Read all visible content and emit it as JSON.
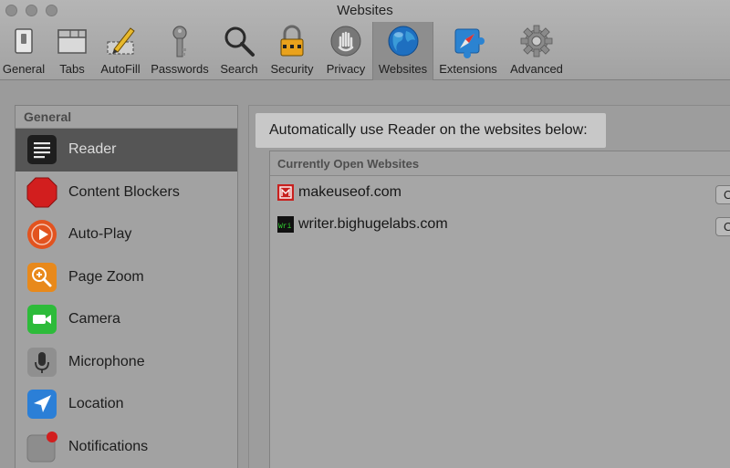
{
  "window": {
    "title": "Websites"
  },
  "toolbar": {
    "items": [
      {
        "label": "General",
        "icon": "general-switch-icon"
      },
      {
        "label": "Tabs",
        "icon": "tabs-icon"
      },
      {
        "label": "AutoFill",
        "icon": "autofill-pencil-icon"
      },
      {
        "label": "Passwords",
        "icon": "key-icon"
      },
      {
        "label": "Search",
        "icon": "magnifier-icon"
      },
      {
        "label": "Security",
        "icon": "padlock-icon"
      },
      {
        "label": "Privacy",
        "icon": "hand-icon"
      },
      {
        "label": "Websites",
        "icon": "globe-icon",
        "selected": true
      },
      {
        "label": "Extensions",
        "icon": "puzzle-compass-icon"
      },
      {
        "label": "Advanced",
        "icon": "gear-icon"
      }
    ]
  },
  "sidebar": {
    "header": "General",
    "items": [
      {
        "label": "Reader",
        "icon": "reader-lines-icon",
        "selected": true
      },
      {
        "label": "Content Blockers",
        "icon": "stop-sign-icon"
      },
      {
        "label": "Auto-Play",
        "icon": "play-icon"
      },
      {
        "label": "Page Zoom",
        "icon": "zoom-icon"
      },
      {
        "label": "Camera",
        "icon": "camera-icon"
      },
      {
        "label": "Microphone",
        "icon": "microphone-icon"
      },
      {
        "label": "Location",
        "icon": "location-arrow-icon"
      },
      {
        "label": "Notifications",
        "icon": "notifications-icon"
      }
    ]
  },
  "content": {
    "headline": "Automatically use Reader on the websites below:",
    "table_header": "Currently Open Websites",
    "sites": [
      {
        "name": "makeuseof.com",
        "favicon": "makeuseof-favicon",
        "setting": "O"
      },
      {
        "name": "writer.bighugelabs.com",
        "favicon": "writer-favicon",
        "favicon_text": "Wri",
        "setting": "O"
      }
    ]
  },
  "colors": {
    "selected_sidebar": "#555555",
    "highlight": "#c8c8c8",
    "globe": "#1e6fc0",
    "stop_sign": "#d21e1e",
    "autoplay": "#e2531f",
    "zoom": "#e8891b",
    "camera": "#2dbb3a",
    "location": "#2b7fd7"
  }
}
